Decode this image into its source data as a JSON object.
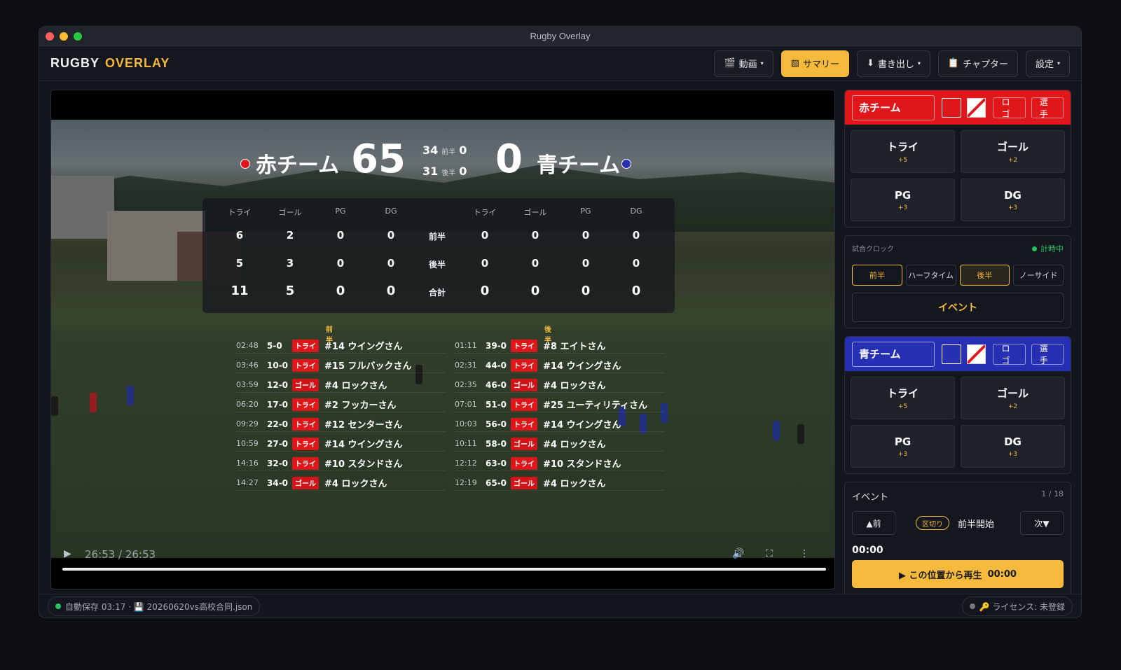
{
  "window": {
    "title": "Rugby Overlay"
  },
  "app": {
    "logo_a": "RUGBY",
    "logo_b": "OVERLAY"
  },
  "toolbar": [
    {
      "icon": "🎬",
      "label": "動画",
      "caret": true
    },
    {
      "icon": "▧",
      "label": "サマリー",
      "caret": false,
      "active": true
    },
    {
      "icon": "⬇",
      "label": "書き出し",
      "caret": true
    },
    {
      "icon": "📋",
      "label": "チャプター",
      "caret": false
    },
    {
      "icon": "",
      "label": "設定",
      "caret": true
    }
  ],
  "scoreboard": {
    "home": {
      "name": "赤チーム",
      "score": "65",
      "first_half": "34",
      "second_half": "31",
      "color": "#e0161b"
    },
    "away": {
      "name": "青チーム",
      "score": "0",
      "first_half": "0",
      "second_half": "0",
      "color": "#2730b3"
    },
    "first_half_label": "前半",
    "second_half_label": "後半"
  },
  "stats": {
    "headers": [
      "トライ",
      "ゴール",
      "PG",
      "DG"
    ],
    "rows": [
      {
        "label": "前半",
        "home": [
          "6",
          "2",
          "0",
          "0"
        ],
        "away": [
          "0",
          "0",
          "0",
          "0"
        ]
      },
      {
        "label": "後半",
        "home": [
          "5",
          "3",
          "0",
          "0"
        ],
        "away": [
          "0",
          "0",
          "0",
          "0"
        ]
      },
      {
        "label": "合計",
        "home": [
          "11",
          "5",
          "0",
          "0"
        ],
        "away": [
          "0",
          "0",
          "0",
          "0"
        ]
      }
    ]
  },
  "timeline": {
    "first_header": "前半",
    "second_header": "後半",
    "first": [
      {
        "time": "02:48",
        "score": "5-0",
        "type": "トライ",
        "name": "#14 ウイングさん"
      },
      {
        "time": "03:46",
        "score": "10-0",
        "type": "トライ",
        "name": "#15 フルバックさん"
      },
      {
        "time": "03:59",
        "score": "12-0",
        "type": "ゴール",
        "name": "#4 ロックさん"
      },
      {
        "time": "06:20",
        "score": "17-0",
        "type": "トライ",
        "name": "#2 フッカーさん"
      },
      {
        "time": "09:29",
        "score": "22-0",
        "type": "トライ",
        "name": "#12 センターさん"
      },
      {
        "time": "10:59",
        "score": "27-0",
        "type": "トライ",
        "name": "#14 ウイングさん"
      },
      {
        "time": "14:16",
        "score": "32-0",
        "type": "トライ",
        "name": "#10 スタンドさん"
      },
      {
        "time": "14:27",
        "score": "34-0",
        "type": "ゴール",
        "name": "#4 ロックさん"
      }
    ],
    "second": [
      {
        "time": "01:11",
        "score": "39-0",
        "type": "トライ",
        "name": "#8 エイトさん"
      },
      {
        "time": "02:31",
        "score": "44-0",
        "type": "トライ",
        "name": "#14 ウイングさん"
      },
      {
        "time": "02:35",
        "score": "46-0",
        "type": "ゴール",
        "name": "#4 ロックさん"
      },
      {
        "time": "07:01",
        "score": "51-0",
        "type": "トライ",
        "name": "#25 ユーティリティさん"
      },
      {
        "time": "10:03",
        "score": "56-0",
        "type": "トライ",
        "name": "#14 ウイングさん"
      },
      {
        "time": "10:11",
        "score": "58-0",
        "type": "ゴール",
        "name": "#4 ロックさん"
      },
      {
        "time": "12:12",
        "score": "63-0",
        "type": "トライ",
        "name": "#10 スタンドさん"
      },
      {
        "time": "12:19",
        "score": "65-0",
        "type": "ゴール",
        "name": "#4 ロックさん"
      }
    ]
  },
  "player": {
    "time": "26:53 / 26:53",
    "progress": 1.0
  },
  "home_panel": {
    "name": "赤チーム",
    "color": "#e0161b",
    "logo_btn": "ロゴ",
    "players_btn": "選手",
    "buttons": [
      {
        "label": "トライ",
        "points": "+5"
      },
      {
        "label": "ゴール",
        "points": "+2"
      },
      {
        "label": "PG",
        "points": "+3"
      },
      {
        "label": "DG",
        "points": "+3"
      }
    ]
  },
  "away_panel": {
    "name": "青チーム",
    "color": "#2730b3",
    "logo_btn": "ロゴ",
    "players_btn": "選手",
    "buttons": [
      {
        "label": "トライ",
        "points": "+5"
      },
      {
        "label": "ゴール",
        "points": "+2"
      },
      {
        "label": "PG",
        "points": "+3"
      },
      {
        "label": "DG",
        "points": "+3"
      }
    ]
  },
  "clock": {
    "title": "試合クロック",
    "status": "計時中",
    "phases": [
      "前半",
      "ハーフタイム",
      "後半",
      "ノーサイド"
    ],
    "event_button": "イベント"
  },
  "events": {
    "title": "イベント",
    "counter": "1 / 18",
    "prev": "▲前",
    "next": "次▼",
    "tag": "区切り",
    "desc": "前半開始",
    "time": "00:00",
    "play_label": "▶ この位置から再生",
    "play_time": "00:00"
  },
  "status": {
    "autosave": "自動保存 03:17 · 💾 20260620vs高校合同.json",
    "license": "🔑 ライセンス: 未登録"
  }
}
